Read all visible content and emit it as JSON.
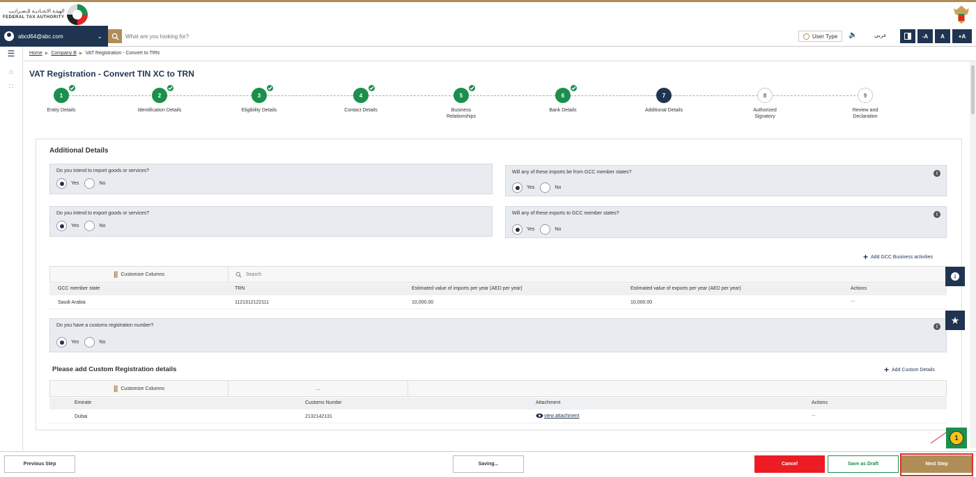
{
  "header": {
    "logo_ar": "الهيئـة الاتحـاديـة للـضـرائـب",
    "logo_en": "FEDERAL TAX AUTHORITY"
  },
  "nav": {
    "account": "abcd64@abc.com",
    "search_placeholder": "What are you looking for?",
    "user_type": "User Type",
    "arabic": "عربي",
    "font_minus": "-A",
    "font_normal": "A",
    "font_plus": "+A"
  },
  "breadcrumb": {
    "home": "Home",
    "company": "Company B",
    "current": "VAT Registration - Convert to TRN"
  },
  "page_title": "VAT Registration - Convert TIN XC to TRN",
  "steps": [
    {
      "num": "1",
      "label": "Entity Details",
      "state": "done"
    },
    {
      "num": "2",
      "label": "Identification Details",
      "state": "done"
    },
    {
      "num": "3",
      "label": "Eligibility Details",
      "state": "done"
    },
    {
      "num": "4",
      "label": "Contact Details",
      "state": "done"
    },
    {
      "num": "5",
      "label": "Business Relationships",
      "state": "done"
    },
    {
      "num": "6",
      "label": "Bank Details",
      "state": "done"
    },
    {
      "num": "7",
      "label": "Additional Details",
      "state": "current"
    },
    {
      "num": "8",
      "label": "Authorized Signatory",
      "state": "todo"
    },
    {
      "num": "9",
      "label": "Review and Declaration",
      "state": "todo"
    }
  ],
  "additional": {
    "title": "Additional Details",
    "q_import": "Do you intend to import goods or services?",
    "q_import_gcc": "Will any of these imports be from GCC member states?",
    "q_export": "Do you intend to export goods or services?",
    "q_export_gcc": "Will any of these exports to GCC member states?",
    "q_customs": "Do you have a customs registration number?",
    "yes": "Yes",
    "no": "No"
  },
  "gcc_table": {
    "add_label": "Add GCC Business activities",
    "customize": "Customize Columns",
    "search": "Search",
    "headers": [
      "GCC member state",
      "TRN",
      "Estimated value of imports per year (AED per year)",
      "Estimated value of exports per year (AED per year)",
      "Actions"
    ],
    "row": [
      "Saudi Arabia",
      "1121312122111",
      "10,000.00",
      "10,000.00",
      "..."
    ]
  },
  "custom_table": {
    "title": "Please add Custom Registration details",
    "add_label": "Add Custom Details",
    "customize": "Customize Columns",
    "more": "...",
    "headers": [
      "Emirate",
      "Customs Numbe",
      "Attachment",
      "Actions"
    ],
    "row": [
      "Dubai",
      "2132142131",
      "view attachment",
      "..."
    ]
  },
  "footer": {
    "previous": "Previous Step",
    "saving": "Saving...",
    "cancel": "Cancel",
    "draft": "Save as Draft",
    "next": "Next Step"
  },
  "annotation": {
    "marker": "1"
  },
  "colors": {
    "navy": "#1f3450",
    "gold": "#b08d57",
    "green": "#1b8f4c",
    "red": "#ed1c24"
  }
}
